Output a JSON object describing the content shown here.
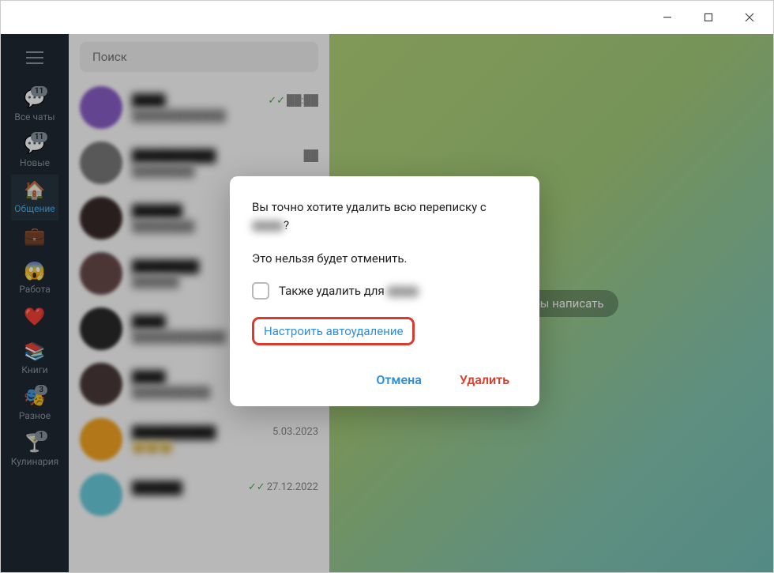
{
  "titlebar": {
    "minimize": "minimize",
    "maximize": "maximize",
    "close": "close"
  },
  "folders": {
    "items": [
      {
        "icon": "💬",
        "label": "Все чаты",
        "badge": "11"
      },
      {
        "icon": "💬",
        "label": "Новые",
        "badge": "11"
      },
      {
        "icon": "🏠",
        "label": "Общение",
        "badge": ""
      },
      {
        "icon": "💼",
        "label": "",
        "badge": ""
      },
      {
        "icon": "😱",
        "label": "Работа",
        "badge": ""
      },
      {
        "icon": "❤️",
        "label": "",
        "badge": ""
      },
      {
        "icon": "📚",
        "label": "Книги",
        "badge": ""
      },
      {
        "icon": "🎭",
        "label": "Разное",
        "badge": "3"
      },
      {
        "icon": "🍸",
        "label": "Кулинария",
        "badge": "1"
      }
    ]
  },
  "search": {
    "placeholder": "Поиск"
  },
  "chats": [
    {
      "avatar": "#8a5fc9",
      "name": "████",
      "time": "██:██",
      "msg": "████████████",
      "ticks": true
    },
    {
      "avatar": "#7a7a7a",
      "name": "██████████",
      "time": "██",
      "msg": "████████",
      "ticks": false
    },
    {
      "avatar": "#3a2a2a",
      "name": "██████",
      "time": "",
      "msg": "████████",
      "ticks": false
    },
    {
      "avatar": "#6a4a4a",
      "name": "████████",
      "time": "",
      "msg": "██████",
      "ticks": false
    },
    {
      "avatar": "#2a2a2a",
      "name": "████",
      "time": "",
      "msg": "████████████",
      "ticks": false
    },
    {
      "avatar": "#4a3a3a",
      "name": "████",
      "time": "",
      "msg": "██████████",
      "ticks": false
    },
    {
      "avatar": "#f5a623",
      "name": "██████████",
      "time": "5.03.2023",
      "msg": "😀😀😀",
      "ticks": false
    },
    {
      "avatar": "#6acdde",
      "name": "██████",
      "time": "27.12.2022",
      "msg": "",
      "ticks": true
    }
  ],
  "chatpane": {
    "hint": "отели бы написать"
  },
  "dialog": {
    "line1": "Вы точно хотите удалить всю переписку с",
    "line1_suffix": "?",
    "line2": "Это нельзя будет отменить.",
    "checkbox_label": "Также удалить для",
    "autodelete": "Настроить автоудаление",
    "cancel": "Отмена",
    "delete": "Удалить"
  }
}
